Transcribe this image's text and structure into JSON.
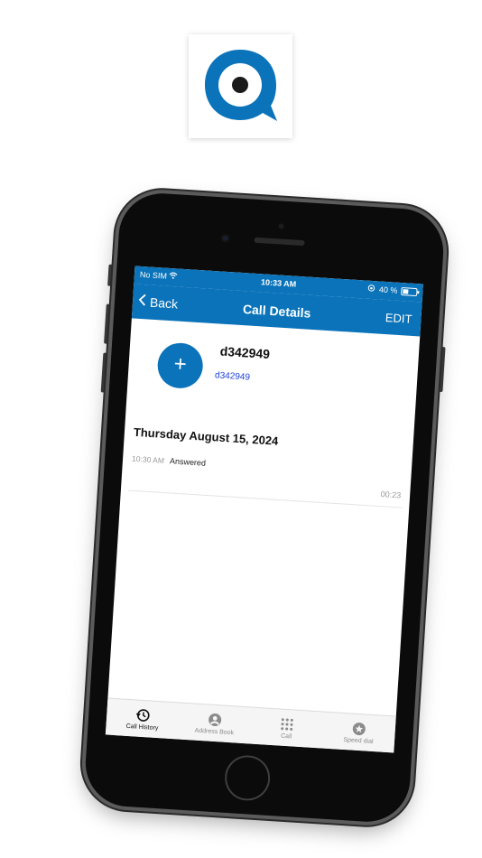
{
  "status_bar": {
    "carrier": "No SIM",
    "time": "10:33 AM",
    "battery_text": "40 %",
    "battery_level": 0.4
  },
  "nav": {
    "back_label": "Back",
    "title": "Call Details",
    "edit_label": "EDIT"
  },
  "contact": {
    "name": "d342949",
    "number": "d342949",
    "add_symbol": "+"
  },
  "call_log": {
    "date_heading": "Thursday August 15, 2024",
    "entries": [
      {
        "time": "10:30 AM",
        "status": "Answered",
        "duration": "00:23"
      }
    ]
  },
  "tabs": [
    {
      "label": "Call History",
      "icon": "clock-history-icon",
      "active": true
    },
    {
      "label": "Address Book",
      "icon": "person-icon",
      "active": false
    },
    {
      "label": "Call",
      "icon": "keypad-icon",
      "active": false
    },
    {
      "label": "Speed dial",
      "icon": "star-icon",
      "active": false
    }
  ],
  "colors": {
    "brand_blue": "#0a73ba",
    "link_blue": "#1a3fd8"
  }
}
